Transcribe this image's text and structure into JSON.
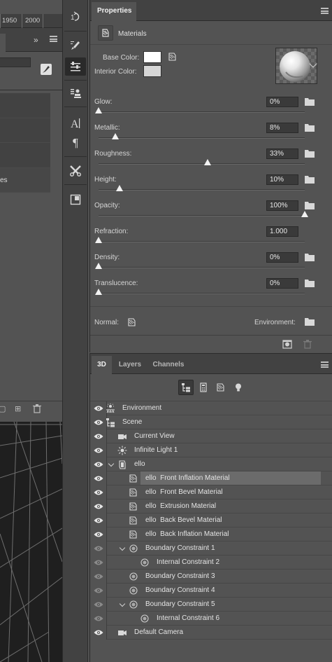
{
  "left_panel": {
    "ruler_labels": [
      "1950",
      "2000"
    ],
    "list_items": [
      "",
      "",
      "",
      "es"
    ]
  },
  "properties": {
    "tab_label": "Properties",
    "section_label": "Materials",
    "base_color_label": "Base Color:",
    "interior_color_label": "Interior Color:",
    "base_color": "#ffffff",
    "interior_color": "#d6d6d6",
    "params": [
      {
        "label": "Glow:",
        "value": "0%",
        "fraction": 0.0
      },
      {
        "label": "Metallic:",
        "value": "8%",
        "fraction": 0.08
      },
      {
        "label": "Roughness:",
        "value": "33%",
        "fraction": 0.53
      },
      {
        "label": "Height:",
        "value": "10%",
        "fraction": 0.1
      },
      {
        "label": "Opacity:",
        "value": "100%",
        "fraction": 1.0
      },
      {
        "label": "Refraction:",
        "value": "1.000",
        "fraction": 0.0
      },
      {
        "label": "Density:",
        "value": "0%",
        "fraction": 0.0
      },
      {
        "label": "Translucence:",
        "value": "0%",
        "fraction": 0.0
      }
    ],
    "normal_label": "Normal:",
    "environment_label": "Environment:"
  },
  "panel3d": {
    "tabs": [
      "3D",
      "Layers",
      "Channels"
    ],
    "tree": [
      {
        "label": "Environment",
        "icon": "environment-icon",
        "level": 0,
        "caret": false,
        "eye": true
      },
      {
        "label": "Scene",
        "icon": "scene-icon",
        "level": 0,
        "caret": false,
        "eye": true
      },
      {
        "label": "Current View",
        "icon": "camera-icon",
        "level": 1,
        "caret": false,
        "eye": true
      },
      {
        "label": "Infinite Light 1",
        "icon": "light-icon",
        "level": 1,
        "caret": false,
        "eye": true
      },
      {
        "label": "ello",
        "icon": "mesh-icon",
        "level": 1,
        "caret": true,
        "eye": true
      },
      {
        "label": "ello  Front Inflation Material",
        "icon": "material-icon",
        "level": 2,
        "caret": false,
        "eye": true,
        "selected": true
      },
      {
        "label": "ello  Front Bevel Material",
        "icon": "material-icon",
        "level": 2,
        "caret": false,
        "eye": true
      },
      {
        "label": "ello  Extrusion Material",
        "icon": "material-icon",
        "level": 2,
        "caret": false,
        "eye": true
      },
      {
        "label": "ello  Back Bevel Material",
        "icon": "material-icon",
        "level": 2,
        "caret": false,
        "eye": true
      },
      {
        "label": "ello  Back Inflation Material",
        "icon": "material-icon",
        "level": 2,
        "caret": false,
        "eye": true
      },
      {
        "label": "Boundary Constraint 1",
        "icon": "constraint-icon",
        "level": 2,
        "caret": true,
        "eye": false
      },
      {
        "label": "Internal Constraint 2",
        "icon": "constraint-icon",
        "level": 3,
        "caret": false,
        "eye": false
      },
      {
        "label": "Boundary Constraint 3",
        "icon": "constraint-icon",
        "level": 2,
        "caret": false,
        "eye": false
      },
      {
        "label": "Boundary Constraint 4",
        "icon": "constraint-icon",
        "level": 2,
        "caret": false,
        "eye": false
      },
      {
        "label": "Boundary Constraint 5",
        "icon": "constraint-icon",
        "level": 2,
        "caret": true,
        "eye": false
      },
      {
        "label": "Internal Constraint 6",
        "icon": "constraint-icon",
        "level": 3,
        "caret": false,
        "eye": false
      },
      {
        "label": "Default Camera",
        "icon": "camera-icon",
        "level": 1,
        "caret": false,
        "eye": true
      }
    ]
  }
}
